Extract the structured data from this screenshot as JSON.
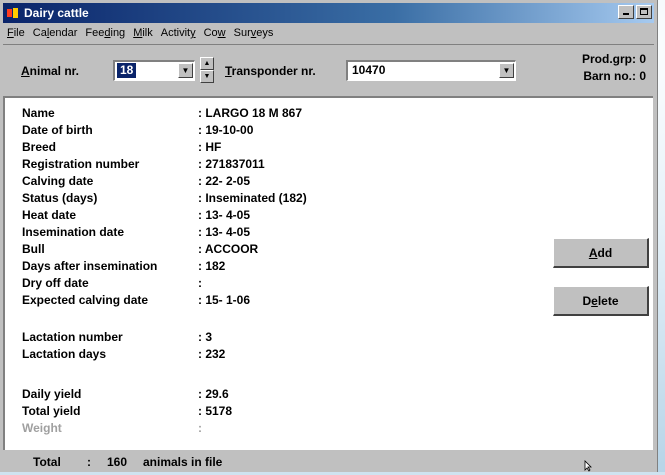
{
  "window": {
    "title": "Dairy cattle",
    "icon": "cow-app-icon"
  },
  "menu": [
    {
      "label": "File",
      "ul": "F",
      "rest": "ile",
      "pre": ""
    },
    {
      "label": "Calendar",
      "pre": "Ca",
      "ul": "l",
      "rest": "endar"
    },
    {
      "label": "Feeding",
      "pre": "Fee",
      "ul": "d",
      "rest": "ing"
    },
    {
      "label": "Milk",
      "pre": "",
      "ul": "M",
      "rest": "ilk"
    },
    {
      "label": "Activity",
      "pre": "Activit",
      "ul": "y",
      "rest": ""
    },
    {
      "label": "Cow",
      "pre": "Co",
      "ul": "w",
      "rest": ""
    },
    {
      "label": "Surveys",
      "pre": "Sur",
      "ul": "v",
      "rest": "eys"
    }
  ],
  "toolbar": {
    "animal_label_ul": "A",
    "animal_label_rest": "nimal nr.",
    "animal_value": "18",
    "transponder_label_ul": "T",
    "transponder_label_rest": "ransponder nr.",
    "transponder_value": "10470",
    "prod_grp": "Prod.grp: 0",
    "barn_no": "Barn no.: 0"
  },
  "details": [
    {
      "key": "Name",
      "value": ": LARGO 18 M 867"
    },
    {
      "key": "Date of birth",
      "value": ": 19-10-00"
    },
    {
      "key": "Breed",
      "value": ": HF"
    },
    {
      "key": "Registration number",
      "value": ": 271837011"
    },
    {
      "key": "Calving date",
      "value": ": 22- 2-05"
    },
    {
      "key": "Status (days)",
      "value": ": Inseminated (182)"
    },
    {
      "key": "Heat date",
      "value": ": 13- 4-05"
    },
    {
      "key": "Insemination date",
      "value": ": 13- 4-05"
    },
    {
      "key": "Bull",
      "value": ": ACCOOR"
    },
    {
      "key": "Days after insemination",
      "value": ": 182"
    },
    {
      "key": "Dry off date",
      "value": ":"
    },
    {
      "key": "Expected calving date",
      "value": ": 15- 1-06"
    },
    {
      "key": "Lactation number",
      "value": ": 3"
    },
    {
      "key": "Lactation days",
      "value": ": 232"
    },
    {
      "key": "Daily yield",
      "value": ": 29.6"
    },
    {
      "key": "Total yield",
      "value": ": 5178"
    },
    {
      "key": "Weight",
      "value": ":"
    }
  ],
  "buttons": {
    "add_ul": "A",
    "add_rest": "dd",
    "delete_pre": "D",
    "delete_ul": "e",
    "delete_rest": "lete"
  },
  "footer": {
    "total_label": "Total",
    "sep": ":",
    "count": "160",
    "suffix": "animals in file"
  }
}
